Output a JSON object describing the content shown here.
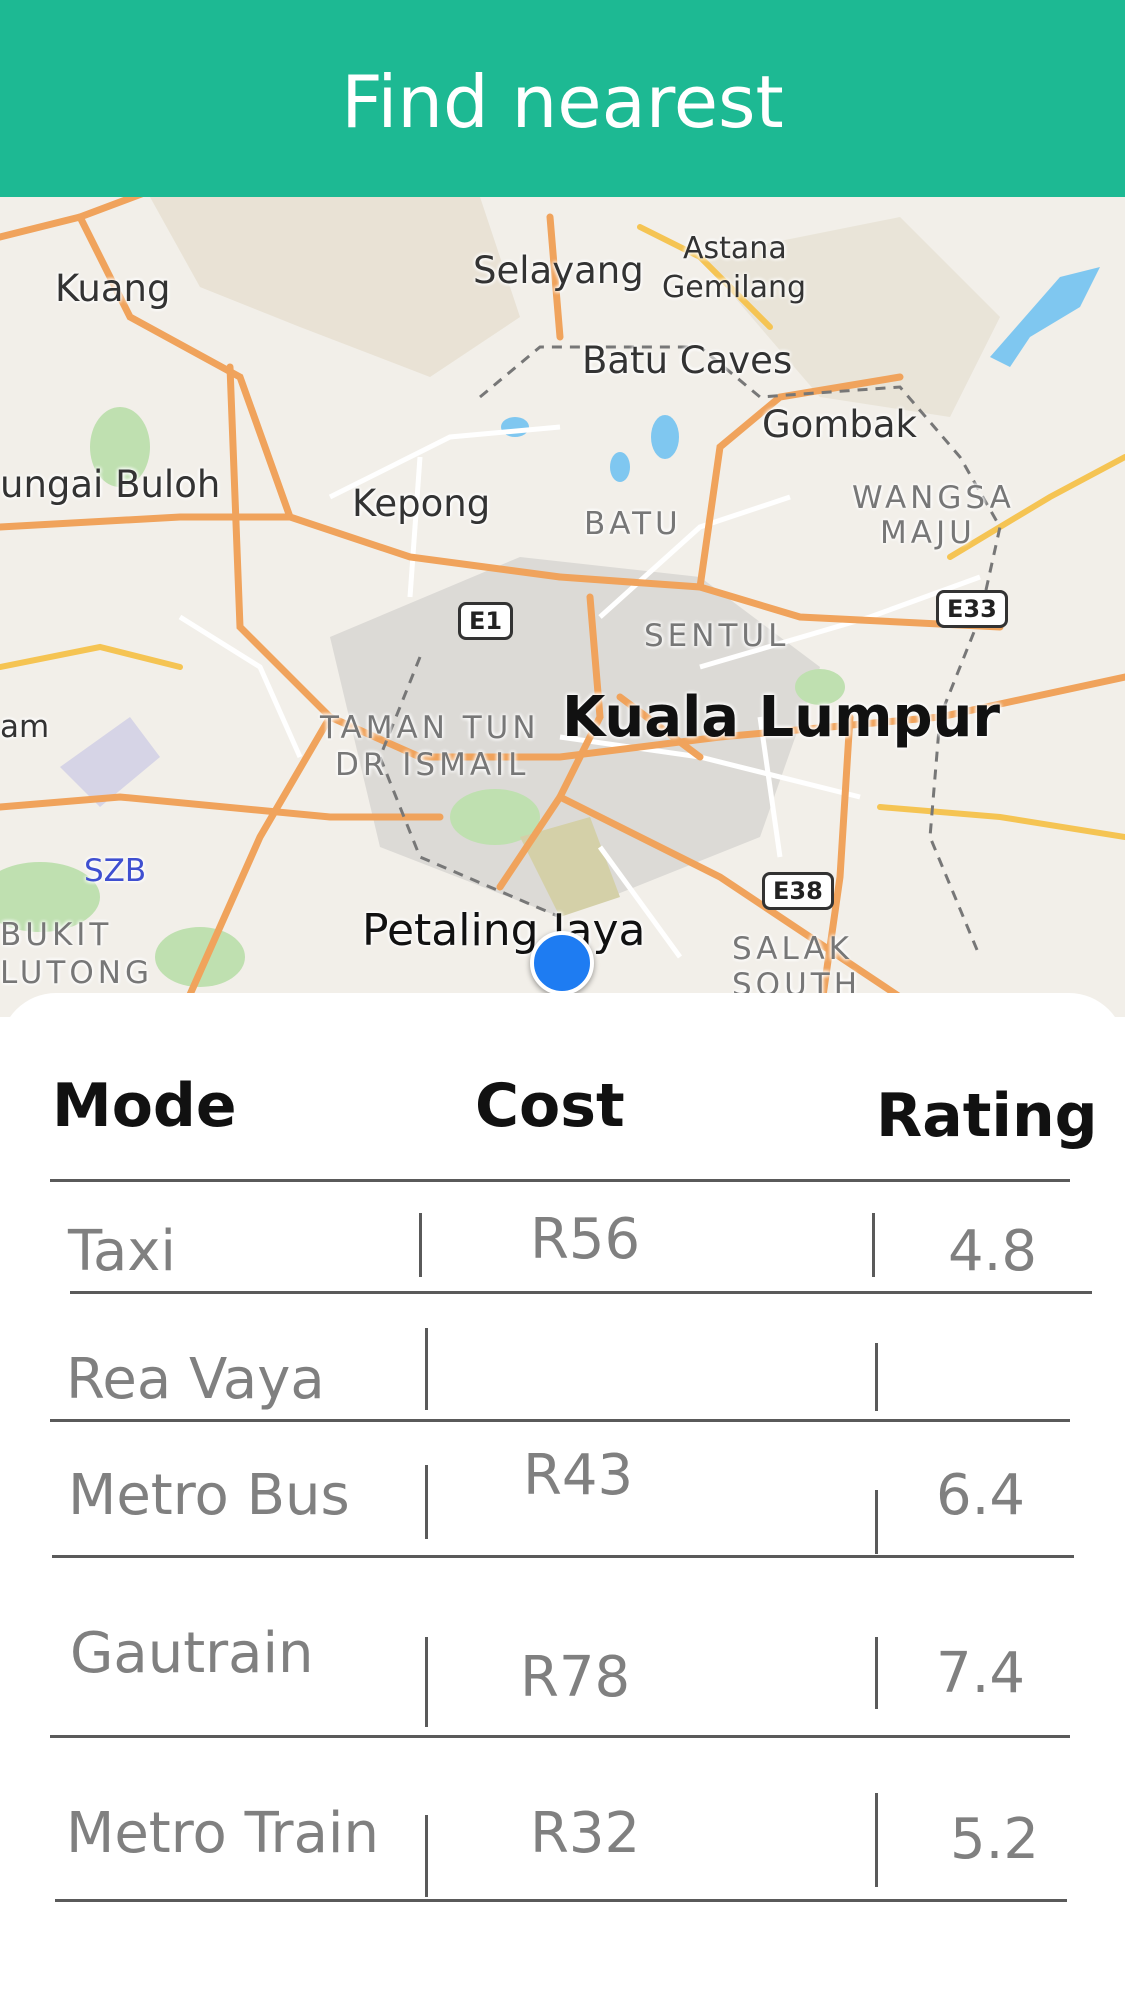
{
  "header": {
    "title": "Find nearest"
  },
  "map": {
    "places": {
      "kuang": "Kuang",
      "selayang": "Selayang",
      "astana": "Astana",
      "gemilang": "Gemilang",
      "batu_caves": "Batu Caves",
      "gombak": "Gombak",
      "sungai_buloh": "ungai Buloh",
      "kepong": "Kepong",
      "batu": "BATU",
      "wangsa": "WANGSA",
      "maju": "MAJU",
      "sentul": "SENTUL",
      "kuala_lumpur": "Kuala Lumpur",
      "taman_tun": "TAMAN TUN",
      "dr_ismail": "DR ISMAIL",
      "am": "am",
      "szb": "SZB",
      "bukit": "BUKIT",
      "lutong": "LUTONG",
      "petaling_jaya": "Petaling Jaya",
      "salak": "SALAK",
      "south": "SOUTH"
    },
    "highways": {
      "e1": "E1",
      "e33": "E33",
      "e38": "E38"
    },
    "icons": {
      "airport": "airplane-icon",
      "location": "current-location-dot"
    }
  },
  "table": {
    "headers": {
      "mode": "Mode",
      "cost": "Cost",
      "rating": "Rating"
    },
    "rows": [
      {
        "mode": "Taxi",
        "cost": "R56",
        "rating": "4.8"
      },
      {
        "mode": "Rea Vaya",
        "cost": "",
        "rating": ""
      },
      {
        "mode": "Metro Bus",
        "cost": "R43",
        "rating": "6.4"
      },
      {
        "mode": "Gautrain",
        "cost": "R78",
        "rating": "7.4"
      },
      {
        "mode": "Metro Train",
        "cost": "R32",
        "rating": "5.2"
      }
    ]
  },
  "colors": {
    "accent": "#1db993",
    "location": "#1e7cf2",
    "road": "#f0a35c",
    "highway": "#f5c453",
    "park": "#bfe0b0",
    "water": "#7fc7f0"
  }
}
